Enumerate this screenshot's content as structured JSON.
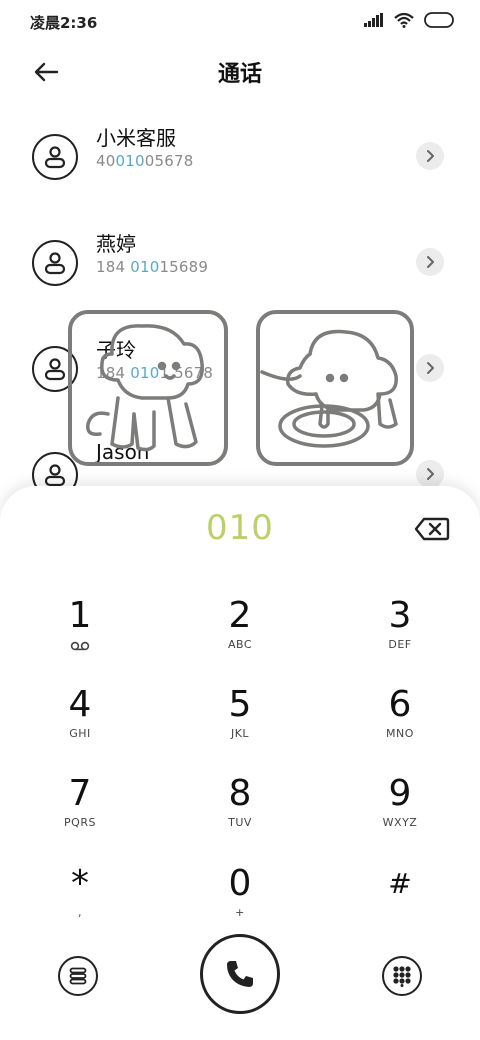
{
  "status_bar": {
    "time": "凌晨2:36"
  },
  "header": {
    "title": "通话"
  },
  "contacts": [
    {
      "name": "小米客服",
      "number_parts": [
        "40",
        "010",
        "05678"
      ]
    },
    {
      "name": "燕婷",
      "number_parts": [
        "184 ",
        "010",
        "15689"
      ]
    },
    {
      "name": "子玲",
      "number_parts": [
        "184 ",
        "010",
        "1 5678"
      ]
    },
    {
      "name": "Jason",
      "number_parts": [
        "",
        "",
        ""
      ]
    }
  ],
  "dialpad": {
    "number": "010",
    "keys": [
      {
        "digit": "1",
        "letters": ""
      },
      {
        "digit": "2",
        "letters": "ABC"
      },
      {
        "digit": "3",
        "letters": "DEF"
      },
      {
        "digit": "4",
        "letters": "GHI"
      },
      {
        "digit": "5",
        "letters": "JKL"
      },
      {
        "digit": "6",
        "letters": "MNO"
      },
      {
        "digit": "7",
        "letters": "PQRS"
      },
      {
        "digit": "8",
        "letters": "TUV"
      },
      {
        "digit": "9",
        "letters": "WXYZ"
      },
      {
        "digit": "*",
        "letters": ","
      },
      {
        "digit": "0",
        "letters": "+"
      },
      {
        "digit": "#",
        "letters": ""
      }
    ]
  },
  "colors": {
    "dial_number": "#bcd06a",
    "match_highlight": "#5aa9c9"
  },
  "icons": {
    "back": "arrow-left-icon",
    "contact": "person-icon",
    "detail": "chevron-right-icon",
    "backspace": "backspace-icon",
    "voicemail": "voicemail-icon",
    "menu": "menu-icon",
    "call": "phone-icon",
    "keypad": "keypad-icon"
  }
}
